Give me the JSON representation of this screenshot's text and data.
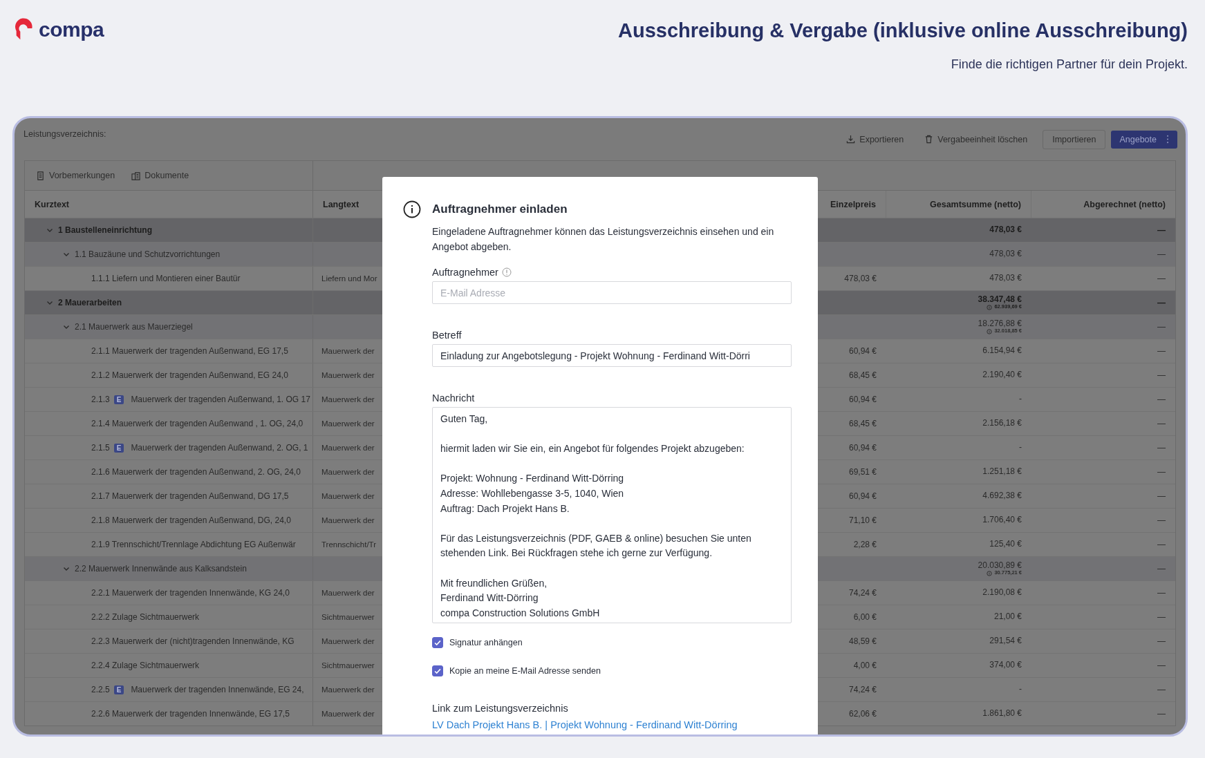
{
  "header": {
    "logo": "compa",
    "title": "Ausschreibung & Vergabe (inklusive online Ausschreibung)",
    "subtitle": "Finde die richtigen Partner für dein Projekt."
  },
  "app": {
    "label": "Leistungsverzeichnis:",
    "actions": [
      {
        "kind": "export",
        "label": "Exportieren"
      },
      {
        "kind": "delete",
        "label": "Vergabeeinheit löschen"
      },
      {
        "kind": "outline",
        "label": "Importieren"
      },
      {
        "kind": "primary",
        "label": "Angebote"
      }
    ],
    "tabs": [
      {
        "kind": "notes",
        "label": "Vorbemerkungen"
      },
      {
        "kind": "documents",
        "label": "Dokumente"
      }
    ],
    "columns": [
      "Kurztext",
      "Langtext",
      "Einzelpreis",
      "Gesamtsumme (netto)",
      "Abgerechnet (netto)"
    ],
    "positions": [
      {
        "kurztext": "1 Baustelleneinrichtung",
        "expanded": true,
        "gesamtsumme": "478,03 €",
        "abgerechnet": "—",
        "children": [
          {
            "kurztext": "1.1 Bauzäune und Schutzvorrichtungen",
            "expanded": true,
            "gesamtsumme": "478,03 €",
            "abgerechnet": "—",
            "children": [
              {
                "kurztext": "1.1.1 Liefern und Montieren einer Bautür",
                "langtext": "Liefern und Mor",
                "einzelpreis": "478,03 €",
                "gesamtsumme": "478,03 €",
                "abgerechnet": "—"
              }
            ]
          }
        ]
      },
      {
        "kurztext": "2 Mauerarbeiten",
        "expanded": true,
        "gesamtsumme": "38.347,48 €",
        "note": "62.939,69 €",
        "abgerechnet": "—",
        "children": [
          {
            "kurztext": "2.1 Mauerwerk aus Mauerziegel",
            "expanded": true,
            "gesamtsumme": "18.276,88 €",
            "note": "32.018,85 €",
            "abgerechnet": "—",
            "children": [
              {
                "kurztext": "2.1.1 Mauerwerk der tragenden Außenwand, EG 17,5",
                "langtext": "Mauerwerk der",
                "einzelpreis": "60,94 €",
                "gesamtsumme": "6.154,94 €",
                "abgerechnet": "—"
              },
              {
                "kurztext": "2.1.2 Mauerwerk der tragenden Außenwand, EG 24,0",
                "langtext": "Mauerwerk der",
                "einzelpreis": "68,45 €",
                "gesamtsumme": "2.190,40 €",
                "abgerechnet": "—"
              },
              {
                "number": "2.1.3",
                "badge": "E",
                "kurztext": "Mauerwerk der tragenden Außenwand, 1. OG 17",
                "langtext": "Mauerwerk der",
                "einzelpreis": "60,94 €",
                "gesamtsumme": "-",
                "abgerechnet": "—"
              },
              {
                "kurztext": "2.1.4 Mauerwerk der tragenden Außenwand , 1. OG, 24,0",
                "langtext": "Mauerwerk der",
                "einzelpreis": "68,45 €",
                "gesamtsumme": "2.156,18 €",
                "abgerechnet": "—"
              },
              {
                "number": "2.1.5",
                "badge": "E",
                "kurztext": "Mauerwerk der tragenden Außenwand, 2. OG, 1",
                "langtext": "Mauerwerk der",
                "einzelpreis": "60,94 €",
                "gesamtsumme": "-",
                "abgerechnet": "—"
              },
              {
                "kurztext": "2.1.6 Mauerwerk der tragenden Außenwand, 2. OG, 24,0",
                "langtext": "Mauerwerk der",
                "einzelpreis": "69,51 €",
                "gesamtsumme": "1.251,18 €",
                "abgerechnet": "—"
              },
              {
                "kurztext": "2.1.7 Mauerwerk der tragenden Außenwand, DG 17,5",
                "langtext": "Mauerwerk der",
                "einzelpreis": "60,94 €",
                "gesamtsumme": "4.692,38 €",
                "abgerechnet": "—"
              },
              {
                "kurztext": "2.1.8 Mauerwerk der tragenden Außenwand, DG, 24,0",
                "langtext": "Mauerwerk der",
                "einzelpreis": "71,10 €",
                "gesamtsumme": "1.706,40 €",
                "abgerechnet": "—"
              },
              {
                "kurztext": "2.1.9 Trennschicht/Trennlage Abdichtung EG Außenwär",
                "langtext": "Trennschicht/Tr",
                "einzelpreis": "2,28 €",
                "gesamtsumme": "125,40 €",
                "abgerechnet": "—"
              }
            ]
          },
          {
            "kurztext": "2.2 Mauerwerk Innenwände aus Kalksandstein",
            "expanded": true,
            "gesamtsumme": "20.030,89 €",
            "note": "30.775,21 €",
            "abgerechnet": "—",
            "children": [
              {
                "kurztext": "2.2.1 Mauerwerk der tragenden Innenwände, KG 24,0",
                "langtext": "Mauerwerk der",
                "einzelpreis": "74,24 €",
                "gesamtsumme": "2.190,08 €",
                "abgerechnet": "—"
              },
              {
                "kurztext": "2.2.2 Zulage Sichtmauerwerk",
                "langtext": "Sichtmauerwer",
                "einzelpreis": "6,00 €",
                "gesamtsumme": "21,00 €",
                "abgerechnet": "—"
              },
              {
                "kurztext": "2.2.3 Mauerwerk der (nicht)tragenden Innenwände, KG",
                "langtext": "Mauerwerk der",
                "einzelpreis": "48,59 €",
                "gesamtsumme": "291,54 €",
                "abgerechnet": "—"
              },
              {
                "kurztext": "2.2.4 Zulage Sichtmauerwerk",
                "langtext": "Sichtmauerwer",
                "einzelpreis": "4,00 €",
                "gesamtsumme": "374,00 €",
                "abgerechnet": "—"
              },
              {
                "number": "2.2.5",
                "badge": "E",
                "kurztext": "Mauerwerk der tragenden Innenwände, EG 24,",
                "langtext": "Mauerwerk der",
                "einzelpreis": "74,24 €",
                "gesamtsumme": "-",
                "abgerechnet": "—"
              },
              {
                "kurztext": "2.2.6 Mauerwerk der tragenden Innenwände, EG 17,5",
                "langtext": "Mauerwerk der",
                "einzelpreis": "62,06 €",
                "gesamtsumme": "1.861,80 €",
                "abgerechnet": "—"
              }
            ]
          }
        ]
      }
    ]
  },
  "modal": {
    "title": "Auftragnehmer einladen",
    "description": "Eingeladene Auftragnehmer können das Leistungsverzeichnis einsehen und ein Angebot abgeben.",
    "recipient": {
      "label": "Auftragnehmer",
      "placeholder": "E-Mail Adresse"
    },
    "subject": {
      "label": "Betreff",
      "value": "Einladung zur Angebotslegung - Projekt Wohnung - Ferdinand Witt-Dörri"
    },
    "message": {
      "label": "Nachricht",
      "value": "Guten Tag,\n\nhiermit laden wir Sie ein, ein Angebot für folgendes Projekt abzugeben:\n\nProjekt: Wohnung - Ferdinand Witt-Dörring\nAdresse: Wohllebengasse 3-5, 1040, Wien\nAuftrag: Dach Projekt Hans B.\n\nFür das Leistungsverzeichnis (PDF, GAEB & online) besuchen Sie unten stehenden Link. Bei Rückfragen stehe ich gerne zur Verfügung.\n\nMit freundlichen Grüßen,\nFerdinand Witt-Dörring\ncompa Construction Solutions GmbH"
    },
    "options": [
      {
        "label": "Signatur anhängen",
        "checked": true
      },
      {
        "label": "Kopie an meine E-Mail Adresse senden",
        "checked": true
      }
    ],
    "link": {
      "label": "Link zum Leistungsverzeichnis",
      "text": "LV Dach Projekt Hans B. | Projekt Wohnung - Ferdinand Witt-Dörring"
    }
  }
}
